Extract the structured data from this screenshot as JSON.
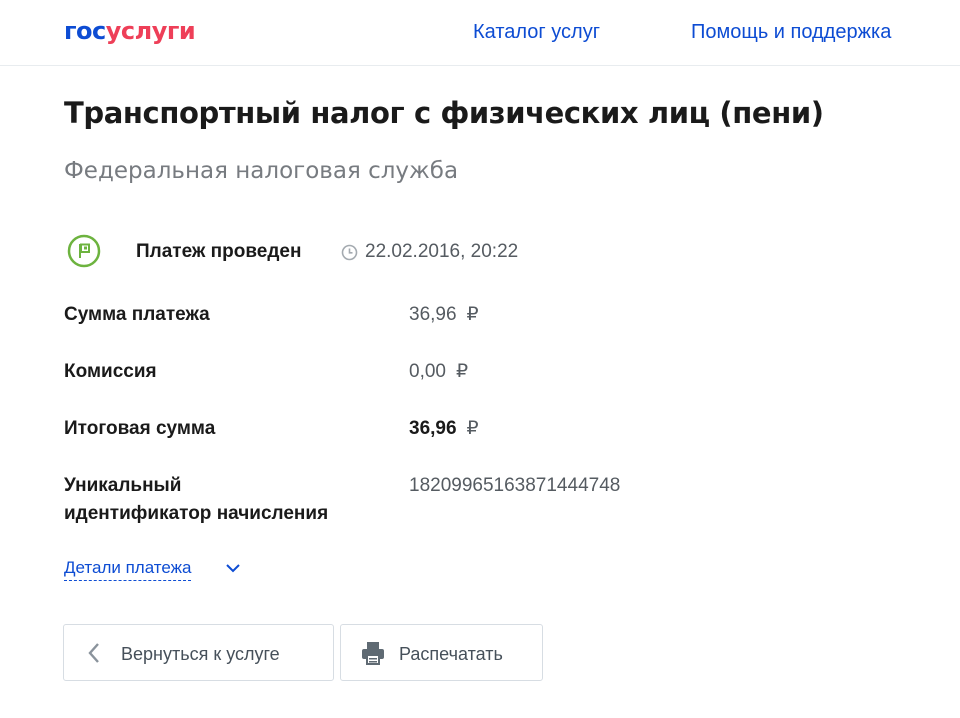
{
  "header": {
    "logo": {
      "part1": "гос",
      "part2": "услуги"
    },
    "nav": {
      "catalog": "Каталог услуг",
      "help": "Помощь и поддержка"
    }
  },
  "page": {
    "title": "Транспортный налог с физических лиц (пени)",
    "subtitle": "Федеральная налоговая служба"
  },
  "status": {
    "label": "Платеж проведен",
    "datetime": "22.02.2016, 20:22",
    "icon": "flag-icon",
    "color": "#6db33f"
  },
  "details": [
    {
      "label": "Сумма платежа",
      "value": "36,96",
      "currency": "₽"
    },
    {
      "label": "Комиссия",
      "value": "0,00",
      "currency": "₽"
    },
    {
      "label": "Итоговая сумма",
      "value": "36,96",
      "currency": "₽"
    },
    {
      "label_line1": "Уникальный",
      "label_line2": "идентификатор начисления",
      "value": "18209965163871444748"
    }
  ],
  "details_link": "Детали платежа",
  "buttons": {
    "back": "Вернуться к услуге",
    "print": "Распечатать"
  },
  "colors": {
    "link": "#0d4cd3",
    "logo_blue": "#0d4cd3",
    "logo_red": "#ee3f58",
    "success": "#6db33f"
  }
}
